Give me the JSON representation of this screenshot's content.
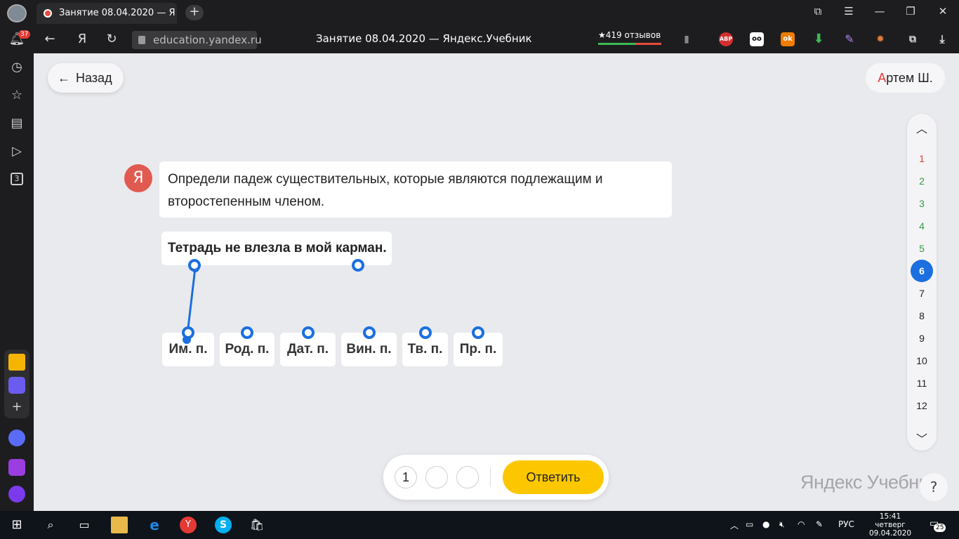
{
  "browser": {
    "tab_title": "Занятие 08.04.2020 — Я",
    "url": "education.yandex.ru",
    "page_title": "Занятие 08.04.2020 — Яндекс.Учебник",
    "reviews": "★419 отзывов",
    "notifications_count": "37",
    "side_box_label": "3",
    "ya_button": "Я",
    "abp_label": "ABP"
  },
  "header": {
    "back_label": "Назад",
    "user_initial": "А",
    "user_rest": "ртем Ш."
  },
  "task": {
    "logo": "Я",
    "instruction": "Определи падеж существительных, которые являются подлежащим и второстепенным членом.",
    "sentence": "Тетрадь не влезла в мой карман."
  },
  "cases": [
    "Им. п.",
    "Род. п.",
    "Дат. п.",
    "Вин. п.",
    "Тв. п.",
    "Пр. п."
  ],
  "question_nav": {
    "numbers": [
      "1",
      "2",
      "3",
      "4",
      "5",
      "6",
      "7",
      "8",
      "9",
      "10",
      "11",
      "12"
    ],
    "active": "6",
    "colors": {
      "1": "#e53935",
      "2": "#2ea043",
      "3": "#2ea043",
      "4": "#2ea043",
      "5": "#2ea043"
    }
  },
  "answer": {
    "slot_value": "1",
    "submit_label": "Ответить"
  },
  "brand": {
    "name": "Яндекс Учебник",
    "help": "?"
  },
  "taskbar": {
    "language": "РУС",
    "time": "15:41",
    "day": "четверг",
    "date": "09.04.2020",
    "notif_count": "25"
  },
  "colors": {
    "accent": "#1b6fe0",
    "submit": "#fdc700",
    "logo_red": "#e05a50"
  }
}
